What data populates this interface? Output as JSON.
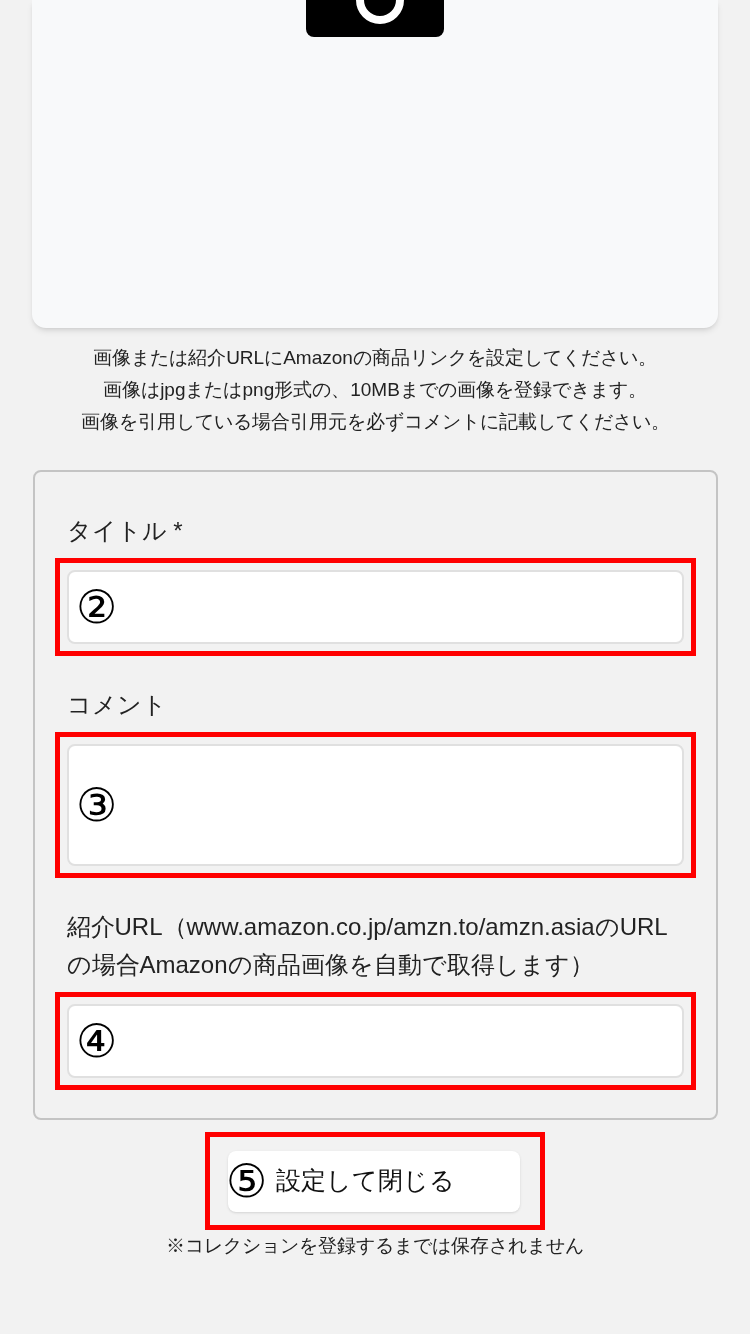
{
  "notes": [
    "画像または紹介URLにAmazonの商品リンクを設定してください。",
    "画像はjpgまたはpng形式の、10MBまでの画像を登録できます。",
    "画像を引用している場合引用元を必ずコメントに記載してください。"
  ],
  "form": {
    "fields": [
      {
        "kind": "input",
        "label": "タイトル *",
        "annotation": "②"
      },
      {
        "kind": "textarea",
        "label": "コメント",
        "annotation": "③"
      },
      {
        "kind": "input",
        "label": "紹介URL（www.amazon.co.jp/amzn.to/amzn.asiaのURLの場合Amazonの商品画像を自動で取得します）",
        "annotation": "④"
      }
    ]
  },
  "button": {
    "label": "設定して閉じる",
    "annotation": "⑤"
  },
  "footnote": "※コレクションを登録するまでは保存されません"
}
